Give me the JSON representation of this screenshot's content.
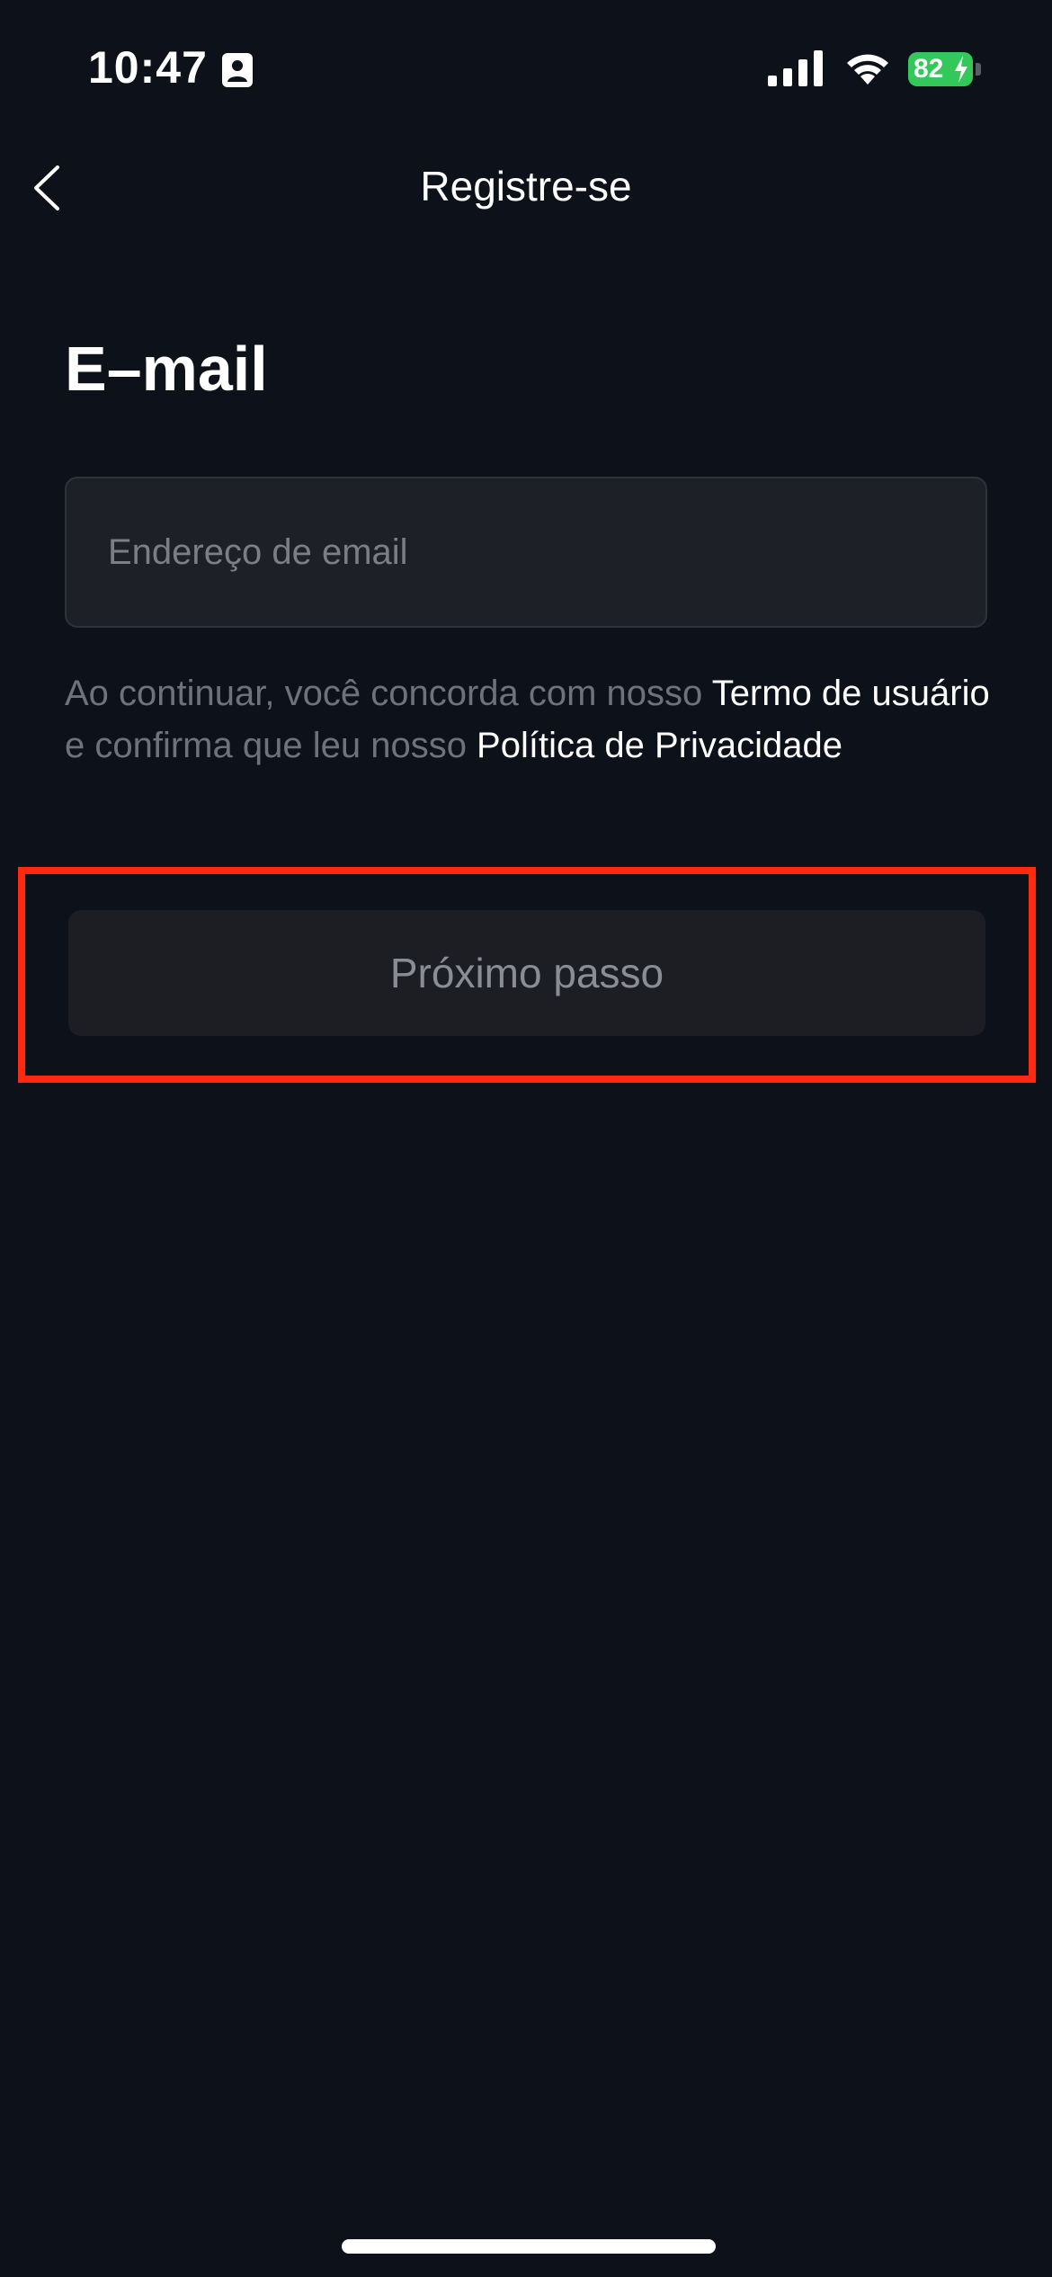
{
  "status_bar": {
    "time": "10:47",
    "battery_percent": "82",
    "icons": [
      "contact-card-icon",
      "cellular-signal-icon",
      "wifi-icon",
      "battery-charging-icon"
    ],
    "battery_color": "#34c759"
  },
  "nav": {
    "title": "Registre-se",
    "back_icon": "chevron-left-icon"
  },
  "form": {
    "heading": "E–mail",
    "email_placeholder": "Endereço de email",
    "email_value": ""
  },
  "consent": {
    "prefix": "Ao continuar, você concorda com nosso ",
    "terms_link": "Termo de usuário",
    "middle": " e confirma que leu nosso ",
    "privacy_link": "Política de Privacidade"
  },
  "actions": {
    "next_label": "Próximo passo",
    "highlight_color": "#ff2a10"
  },
  "colors": {
    "background": "#0d1119",
    "field_background": "#1e2027",
    "button_background": "#1c1e24"
  }
}
